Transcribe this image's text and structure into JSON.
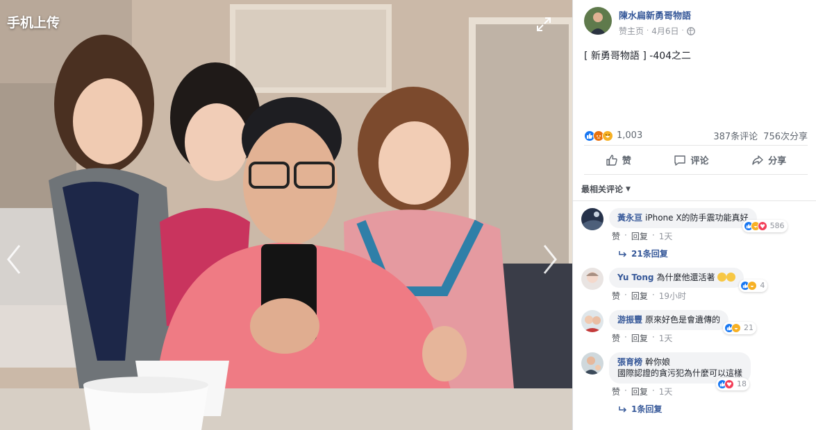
{
  "viewer": {
    "upload_label": "手机上传"
  },
  "post": {
    "page_name": "陳水扁新勇哥物語",
    "audience": "赞主页",
    "date": "4月6日",
    "text": "[ 新勇哥物語 ] -404之二",
    "reaction_count": "1,003",
    "comment_count": "387条评论",
    "share_count": "756次分享"
  },
  "actions": {
    "like": "赞",
    "comment": "评论",
    "share": "分享"
  },
  "comments_header": {
    "sort_label": "最相关评论"
  },
  "comments": [
    {
      "name": "黃永亘",
      "text": "iPhone X的防手震功能真好",
      "reactions": "586",
      "like": "赞",
      "reply": "回复",
      "time": "1天",
      "replies_label": "21条回复"
    },
    {
      "name": "Yu Tong",
      "text": "為什麼他還活著",
      "reactions": "4",
      "like": "赞",
      "reply": "回复",
      "time": "19小时"
    },
    {
      "name": "游振豐",
      "text": "原來好色是會遺傳的",
      "reactions": "21",
      "like": "赞",
      "reply": "回复",
      "time": "1天"
    },
    {
      "name": "張育榜",
      "text": "幹你娘",
      "text2": "國際認證的貪污犯為什麼可以這樣",
      "reactions": "18",
      "like": "赞",
      "reply": "回复",
      "time": "1天",
      "replies_label": "1条回复"
    }
  ],
  "colors": {
    "link": "#365899",
    "like_blue": "#1877f2",
    "bubble": "#f2f3f5"
  }
}
